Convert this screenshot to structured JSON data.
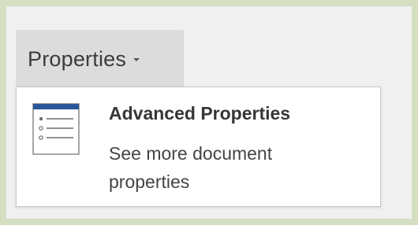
{
  "properties_button": {
    "label": "Properties",
    "caret_icon": "chevron-down-icon"
  },
  "menu": {
    "items": [
      {
        "title": "Advanced Properties",
        "description": "See more document properties",
        "icon": "list-document-icon"
      }
    ]
  },
  "colors": {
    "outer_background": "#d4dfc2",
    "panel_background": "#f0f0f0",
    "button_background": "#dcdcdc",
    "menu_background": "#ffffff",
    "icon_accent": "#2b579a"
  }
}
